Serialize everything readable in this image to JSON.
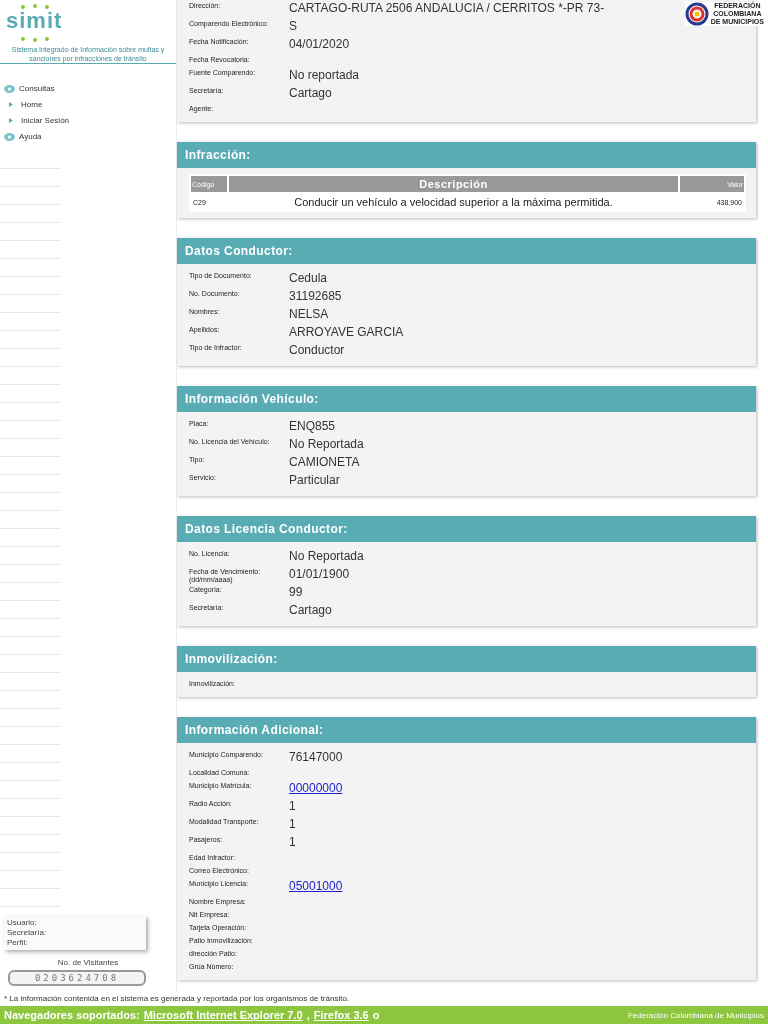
{
  "sidebar": {
    "logo": "simit",
    "tagline": "Sistema Integrado de Información sobre multas y sanciones por infracciones de tránsito",
    "menu": [
      {
        "label": "Consultas",
        "kind": "group"
      },
      {
        "label": "Home",
        "kind": "item"
      },
      {
        "label": "Iniciar Sesión",
        "kind": "item"
      },
      {
        "label": "Ayuda",
        "kind": "group"
      }
    ],
    "user_box": [
      "Usuario:",
      "Secretaría:",
      "Perfil:"
    ],
    "visitors_label": "No. de Visitantes",
    "visitors_count": "0203624708"
  },
  "header": {
    "org_logo": [
      "FEDERACIÓN",
      "COLOMBIANA",
      "DE MUNICIPIOS"
    ]
  },
  "sections": [
    {
      "kind": "fields",
      "fields": [
        {
          "label": "Dirección:",
          "value": "CARTAGO-RUTA 2506 ANDALUCIA / CERRITOS *-PR 73-"
        },
        {
          "label": "Comparendo Electrónico:",
          "value": "S"
        },
        {
          "label": "Fecha Notificación:",
          "value": "04/01/2020"
        },
        {
          "label": "Fecha Revocatoria:"
        },
        {
          "label": "Fuente Comparendo:",
          "value": "No reportada"
        },
        {
          "label": "Secretaría:",
          "value": "Cartago"
        },
        {
          "label": "Agente:"
        }
      ]
    },
    {
      "kind": "table",
      "title": "Infracción:",
      "columns": [
        "Código",
        "Descripción",
        "Valor"
      ],
      "rows": [
        [
          "C29",
          "Conducir un vehículo a velocidad superior a la máxima permitida.",
          "438,900"
        ]
      ]
    },
    {
      "kind": "fields",
      "title": "Datos Conductor:",
      "fields": [
        {
          "label": "Tipo de Documento:",
          "value": "Cedula"
        },
        {
          "label": "No. Documento:",
          "value": "31192685"
        },
        {
          "label": "Nombres:",
          "value": "NELSA"
        },
        {
          "label": "Apellidos:",
          "value": "ARROYAVE GARCIA"
        },
        {
          "label": "Tipo de Infractor:",
          "value": "Conductor"
        }
      ]
    },
    {
      "kind": "fields",
      "title": "Información Vehículo:",
      "fields": [
        {
          "label": "Placa:",
          "value": "ENQ855"
        },
        {
          "label": "No. Licencia del Vehículo:",
          "value": "No Reportada"
        },
        {
          "label": "Tipo:",
          "value": "CAMIONETA"
        },
        {
          "label": "Servicio:",
          "value": "Particular"
        }
      ]
    },
    {
      "kind": "fields",
      "title": "Datos Licencia Conductor:",
      "fields": [
        {
          "label": "No. Licencia:",
          "value": "No Reportada"
        },
        {
          "label": "Fecha de Vencimiento:",
          "sublabel": "(dd/mm/aaaa)",
          "value": "01/01/1900"
        },
        {
          "label": "Categoría:",
          "value": "99"
        },
        {
          "label": "Secretaría:",
          "value": "Cartago"
        }
      ]
    },
    {
      "kind": "fields",
      "title": "Inmovilización:",
      "fields": [
        {
          "label": "Inmovilización:"
        }
      ]
    },
    {
      "kind": "fields",
      "title": "Información Adicional:",
      "fields": [
        {
          "label": "Municipio Comparendo:",
          "value": "76147000"
        },
        {
          "label": "Localidad Comuna:"
        },
        {
          "label": "Municipio Matrícula:",
          "value": "00000000",
          "link": true
        },
        {
          "label": "Radio Acción:",
          "value": "1"
        },
        {
          "label": "Modalidad Transporte:",
          "value": "1"
        },
        {
          "label": "Pasajeros:",
          "value": "1"
        },
        {
          "label": "Edad Infractor:"
        },
        {
          "label": "Correo Electrónico:"
        },
        {
          "label": "Municipio Licencia:",
          "value": "05001000",
          "link": true
        },
        {
          "label": "Nombre Empresa:"
        },
        {
          "label": "Nit Empresa:"
        },
        {
          "label": "Tarjeta Operación:"
        },
        {
          "label": "Patio Inmovilización:"
        },
        {
          "label": "dirección Patio:"
        },
        {
          "label": "Grúa Número:"
        }
      ]
    }
  ],
  "footnote": "* La información contenida en el sistema es generada y reportada por los organismos de tránsito.",
  "footer": {
    "label": "Navegadores soportados:",
    "links": [
      "Microsoft Internet Explorer 7.0",
      "Firefox 3.6"
    ],
    "separator": ",",
    "tail": "o",
    "org": "Federación Colombiana de Municipios"
  }
}
